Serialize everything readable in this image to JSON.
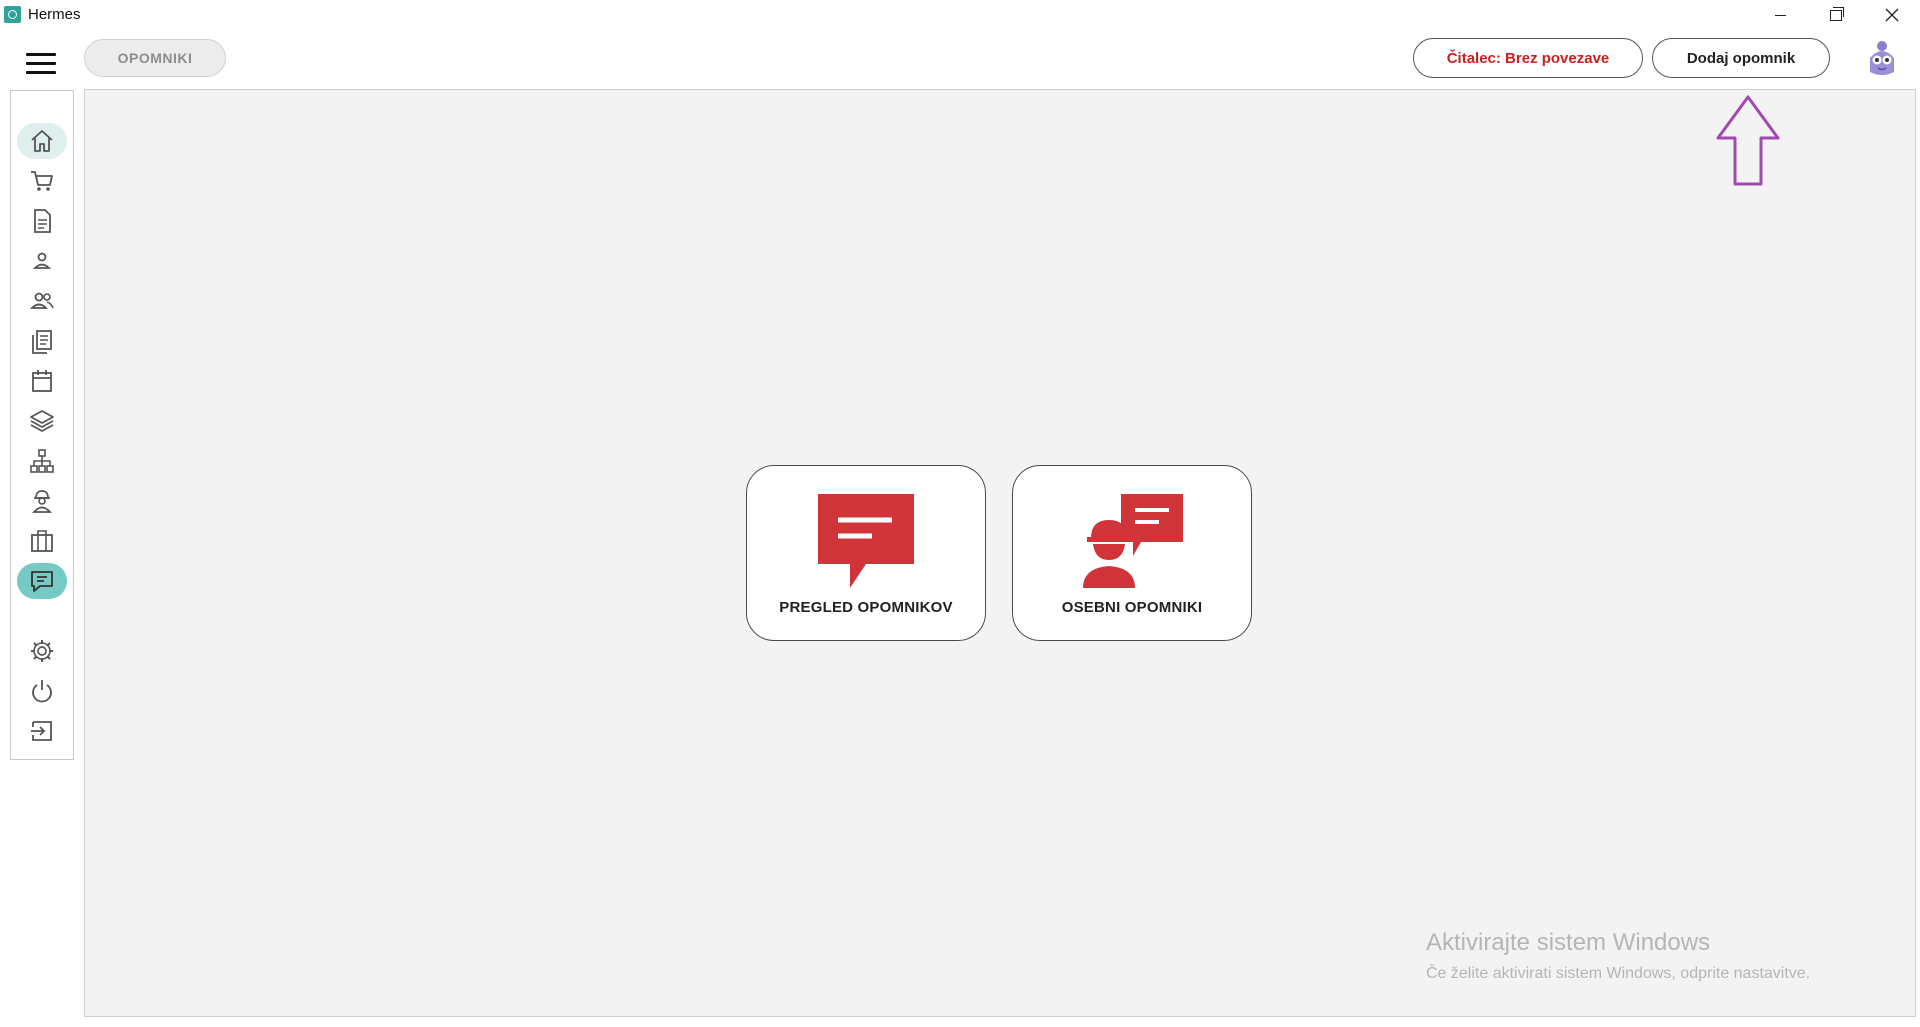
{
  "window": {
    "title": "Hermes"
  },
  "header": {
    "breadcrumb": "OPOMNIKI",
    "status_button": "Čitalec: Brez povezave",
    "add_button": "Dodaj opomnik"
  },
  "sidebar": {
    "items": [
      {
        "icon": "home-icon",
        "active": false,
        "highlight": true
      },
      {
        "icon": "cart-icon",
        "active": false
      },
      {
        "icon": "document-icon",
        "active": false
      },
      {
        "icon": "person-icon",
        "active": false
      },
      {
        "icon": "people-icon",
        "active": false
      },
      {
        "icon": "pages-icon",
        "active": false
      },
      {
        "icon": "calendar-icon",
        "active": false
      },
      {
        "icon": "layers-icon",
        "active": false
      },
      {
        "icon": "org-chart-icon",
        "active": false
      },
      {
        "icon": "worker-icon",
        "active": false
      },
      {
        "icon": "briefcase-icon",
        "active": false
      },
      {
        "icon": "reminder-icon",
        "active": true
      },
      {
        "icon": "gear-icon",
        "active": false
      },
      {
        "icon": "power-icon",
        "active": false
      },
      {
        "icon": "logout-icon",
        "active": false
      }
    ]
  },
  "tiles": [
    {
      "label": "PREGLED OPOMNIKOV",
      "icon": "chat-bubble-icon"
    },
    {
      "label": "OSEBNI OPOMNIKI",
      "icon": "worker-chat-icon"
    }
  ],
  "colors": {
    "accent_red": "#d13438",
    "status_red": "#cc1f1f",
    "sidebar_active": "#76c9c4",
    "arrow_purple": "#a04ab0"
  },
  "watermark": {
    "title": "Aktivirajte sistem Windows",
    "subtitle": "Če želite aktivirati sistem Windows, odprite nastavitve."
  }
}
